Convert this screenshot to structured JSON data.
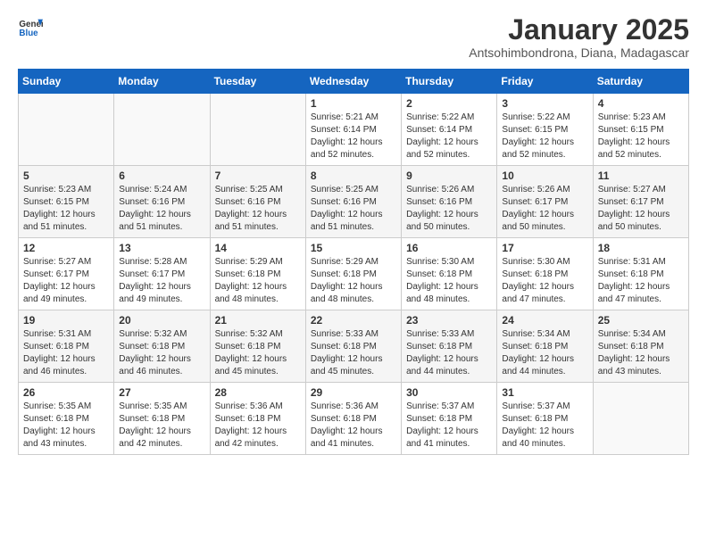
{
  "header": {
    "logo_general": "General",
    "logo_blue": "Blue",
    "month_year": "January 2025",
    "location": "Antsohimbondrona, Diana, Madagascar"
  },
  "weekdays": [
    "Sunday",
    "Monday",
    "Tuesday",
    "Wednesday",
    "Thursday",
    "Friday",
    "Saturday"
  ],
  "weeks": [
    [
      {
        "day": "",
        "sunrise": "",
        "sunset": "",
        "daylight": ""
      },
      {
        "day": "",
        "sunrise": "",
        "sunset": "",
        "daylight": ""
      },
      {
        "day": "",
        "sunrise": "",
        "sunset": "",
        "daylight": ""
      },
      {
        "day": "1",
        "sunrise": "Sunrise: 5:21 AM",
        "sunset": "Sunset: 6:14 PM",
        "daylight": "Daylight: 12 hours and 52 minutes."
      },
      {
        "day": "2",
        "sunrise": "Sunrise: 5:22 AM",
        "sunset": "Sunset: 6:14 PM",
        "daylight": "Daylight: 12 hours and 52 minutes."
      },
      {
        "day": "3",
        "sunrise": "Sunrise: 5:22 AM",
        "sunset": "Sunset: 6:15 PM",
        "daylight": "Daylight: 12 hours and 52 minutes."
      },
      {
        "day": "4",
        "sunrise": "Sunrise: 5:23 AM",
        "sunset": "Sunset: 6:15 PM",
        "daylight": "Daylight: 12 hours and 52 minutes."
      }
    ],
    [
      {
        "day": "5",
        "sunrise": "Sunrise: 5:23 AM",
        "sunset": "Sunset: 6:15 PM",
        "daylight": "Daylight: 12 hours and 51 minutes."
      },
      {
        "day": "6",
        "sunrise": "Sunrise: 5:24 AM",
        "sunset": "Sunset: 6:16 PM",
        "daylight": "Daylight: 12 hours and 51 minutes."
      },
      {
        "day": "7",
        "sunrise": "Sunrise: 5:25 AM",
        "sunset": "Sunset: 6:16 PM",
        "daylight": "Daylight: 12 hours and 51 minutes."
      },
      {
        "day": "8",
        "sunrise": "Sunrise: 5:25 AM",
        "sunset": "Sunset: 6:16 PM",
        "daylight": "Daylight: 12 hours and 51 minutes."
      },
      {
        "day": "9",
        "sunrise": "Sunrise: 5:26 AM",
        "sunset": "Sunset: 6:16 PM",
        "daylight": "Daylight: 12 hours and 50 minutes."
      },
      {
        "day": "10",
        "sunrise": "Sunrise: 5:26 AM",
        "sunset": "Sunset: 6:17 PM",
        "daylight": "Daylight: 12 hours and 50 minutes."
      },
      {
        "day": "11",
        "sunrise": "Sunrise: 5:27 AM",
        "sunset": "Sunset: 6:17 PM",
        "daylight": "Daylight: 12 hours and 50 minutes."
      }
    ],
    [
      {
        "day": "12",
        "sunrise": "Sunrise: 5:27 AM",
        "sunset": "Sunset: 6:17 PM",
        "daylight": "Daylight: 12 hours and 49 minutes."
      },
      {
        "day": "13",
        "sunrise": "Sunrise: 5:28 AM",
        "sunset": "Sunset: 6:17 PM",
        "daylight": "Daylight: 12 hours and 49 minutes."
      },
      {
        "day": "14",
        "sunrise": "Sunrise: 5:29 AM",
        "sunset": "Sunset: 6:18 PM",
        "daylight": "Daylight: 12 hours and 48 minutes."
      },
      {
        "day": "15",
        "sunrise": "Sunrise: 5:29 AM",
        "sunset": "Sunset: 6:18 PM",
        "daylight": "Daylight: 12 hours and 48 minutes."
      },
      {
        "day": "16",
        "sunrise": "Sunrise: 5:30 AM",
        "sunset": "Sunset: 6:18 PM",
        "daylight": "Daylight: 12 hours and 48 minutes."
      },
      {
        "day": "17",
        "sunrise": "Sunrise: 5:30 AM",
        "sunset": "Sunset: 6:18 PM",
        "daylight": "Daylight: 12 hours and 47 minutes."
      },
      {
        "day": "18",
        "sunrise": "Sunrise: 5:31 AM",
        "sunset": "Sunset: 6:18 PM",
        "daylight": "Daylight: 12 hours and 47 minutes."
      }
    ],
    [
      {
        "day": "19",
        "sunrise": "Sunrise: 5:31 AM",
        "sunset": "Sunset: 6:18 PM",
        "daylight": "Daylight: 12 hours and 46 minutes."
      },
      {
        "day": "20",
        "sunrise": "Sunrise: 5:32 AM",
        "sunset": "Sunset: 6:18 PM",
        "daylight": "Daylight: 12 hours and 46 minutes."
      },
      {
        "day": "21",
        "sunrise": "Sunrise: 5:32 AM",
        "sunset": "Sunset: 6:18 PM",
        "daylight": "Daylight: 12 hours and 45 minutes."
      },
      {
        "day": "22",
        "sunrise": "Sunrise: 5:33 AM",
        "sunset": "Sunset: 6:18 PM",
        "daylight": "Daylight: 12 hours and 45 minutes."
      },
      {
        "day": "23",
        "sunrise": "Sunrise: 5:33 AM",
        "sunset": "Sunset: 6:18 PM",
        "daylight": "Daylight: 12 hours and 44 minutes."
      },
      {
        "day": "24",
        "sunrise": "Sunrise: 5:34 AM",
        "sunset": "Sunset: 6:18 PM",
        "daylight": "Daylight: 12 hours and 44 minutes."
      },
      {
        "day": "25",
        "sunrise": "Sunrise: 5:34 AM",
        "sunset": "Sunset: 6:18 PM",
        "daylight": "Daylight: 12 hours and 43 minutes."
      }
    ],
    [
      {
        "day": "26",
        "sunrise": "Sunrise: 5:35 AM",
        "sunset": "Sunset: 6:18 PM",
        "daylight": "Daylight: 12 hours and 43 minutes."
      },
      {
        "day": "27",
        "sunrise": "Sunrise: 5:35 AM",
        "sunset": "Sunset: 6:18 PM",
        "daylight": "Daylight: 12 hours and 42 minutes."
      },
      {
        "day": "28",
        "sunrise": "Sunrise: 5:36 AM",
        "sunset": "Sunset: 6:18 PM",
        "daylight": "Daylight: 12 hours and 42 minutes."
      },
      {
        "day": "29",
        "sunrise": "Sunrise: 5:36 AM",
        "sunset": "Sunset: 6:18 PM",
        "daylight": "Daylight: 12 hours and 41 minutes."
      },
      {
        "day": "30",
        "sunrise": "Sunrise: 5:37 AM",
        "sunset": "Sunset: 6:18 PM",
        "daylight": "Daylight: 12 hours and 41 minutes."
      },
      {
        "day": "31",
        "sunrise": "Sunrise: 5:37 AM",
        "sunset": "Sunset: 6:18 PM",
        "daylight": "Daylight: 12 hours and 40 minutes."
      },
      {
        "day": "",
        "sunrise": "",
        "sunset": "",
        "daylight": ""
      }
    ]
  ]
}
